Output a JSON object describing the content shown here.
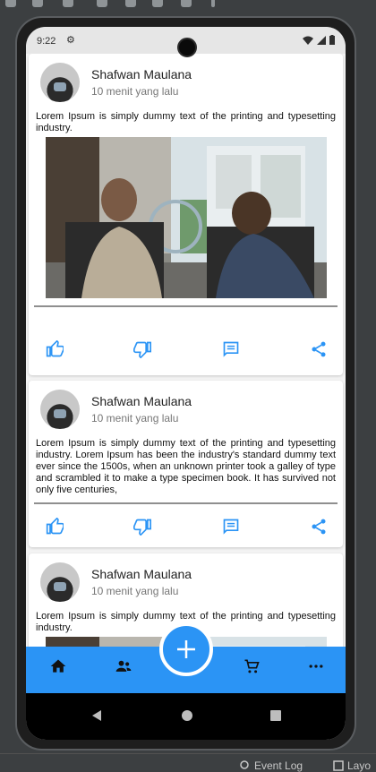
{
  "status_bar": {
    "time": "9:22"
  },
  "posts": [
    {
      "author": "Shafwan Maulana",
      "time_ago": "10 menit yang lalu",
      "text": "Lorem Ipsum is simply dummy text of the printing and typesetting industry.",
      "has_photo": true
    },
    {
      "author": "Shafwan Maulana",
      "time_ago": "10 menit yang lalu",
      "text": "Lorem Ipsum is simply dummy text of the printing and typesetting industry. Lorem Ipsum has been the industry's standard dummy text ever since the 1500s, when an unknown printer took a galley of type and scrambled it to make a type specimen book. It has survived not only five centuries,",
      "has_photo": false
    },
    {
      "author": "Shafwan Maulana",
      "time_ago": "10 menit yang lalu",
      "text": "Lorem Ipsum is simply dummy text of the printing and typesetting industry.",
      "has_photo": true
    }
  ],
  "post_actions": [
    "thumb-up-icon",
    "thumb-down-icon",
    "comment-icon",
    "share-icon"
  ],
  "bottom_nav": [
    "home-icon",
    "people-icon",
    "add-icon",
    "cart-icon",
    "more-icon"
  ],
  "ide_bottom": {
    "event_log": "Event Log",
    "layout": "Layo"
  },
  "colors": {
    "accent": "#2b94f5",
    "icon": "#2b94f5"
  }
}
